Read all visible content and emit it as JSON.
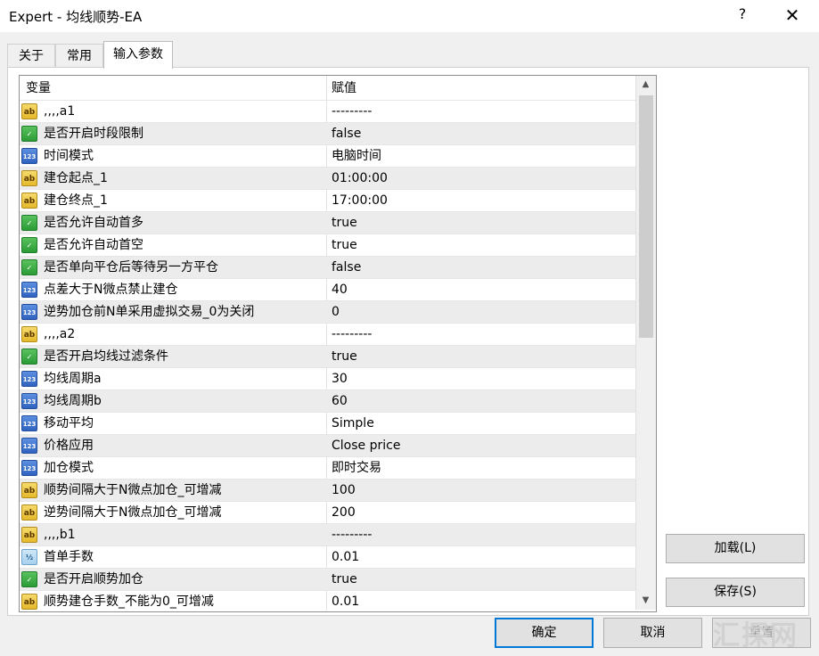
{
  "window": {
    "title": "Expert - 均线顺势-EA",
    "help": "?",
    "close": "✕"
  },
  "tabs": [
    {
      "label": "关于",
      "active": false
    },
    {
      "label": "常用",
      "active": false
    },
    {
      "label": "输入参数",
      "active": true
    }
  ],
  "grid": {
    "col_variable": "变量",
    "col_value": "赋值",
    "rows": [
      {
        "icon": "string",
        "badge": "ab",
        "name": ",,,,a1",
        "value": "---------"
      },
      {
        "icon": "bool",
        "badge": "✓",
        "name": "是否开启时段限制",
        "value": "false"
      },
      {
        "icon": "int",
        "badge": "123",
        "name": "时间模式",
        "value": "电脑时间"
      },
      {
        "icon": "string",
        "badge": "ab",
        "name": "建仓起点_1",
        "value": "01:00:00"
      },
      {
        "icon": "string",
        "badge": "ab",
        "name": "建仓终点_1",
        "value": "17:00:00"
      },
      {
        "icon": "bool",
        "badge": "✓",
        "name": "是否允许自动首多",
        "value": "true"
      },
      {
        "icon": "bool",
        "badge": "✓",
        "name": "是否允许自动首空",
        "value": "true"
      },
      {
        "icon": "bool",
        "badge": "✓",
        "name": "是否单向平仓后等待另一方平仓",
        "value": "false"
      },
      {
        "icon": "int",
        "badge": "123",
        "name": "点差大于N微点禁止建仓",
        "value": "40"
      },
      {
        "icon": "int",
        "badge": "123",
        "name": "逆势加仓前N单采用虚拟交易_0为关闭",
        "value": "0"
      },
      {
        "icon": "string",
        "badge": "ab",
        "name": ",,,,a2",
        "value": "---------"
      },
      {
        "icon": "bool",
        "badge": "✓",
        "name": "是否开启均线过滤条件",
        "value": "true"
      },
      {
        "icon": "int",
        "badge": "123",
        "name": "均线周期a",
        "value": "30"
      },
      {
        "icon": "int",
        "badge": "123",
        "name": "均线周期b",
        "value": "60"
      },
      {
        "icon": "int",
        "badge": "123",
        "name": "移动平均",
        "value": "Simple"
      },
      {
        "icon": "int",
        "badge": "123",
        "name": "价格应用",
        "value": "Close price"
      },
      {
        "icon": "int",
        "badge": "123",
        "name": "加仓模式",
        "value": "即时交易"
      },
      {
        "icon": "string",
        "badge": "ab",
        "name": "顺势间隔大于N微点加仓_可增减",
        "value": "100"
      },
      {
        "icon": "string",
        "badge": "ab",
        "name": "逆势间隔大于N微点加仓_可增减",
        "value": "200"
      },
      {
        "icon": "string",
        "badge": "ab",
        "name": ",,,,b1",
        "value": "---------"
      },
      {
        "icon": "double",
        "badge": "½",
        "name": "首单手数",
        "value": "0.01"
      },
      {
        "icon": "bool",
        "badge": "✓",
        "name": "是否开启顺势加仓",
        "value": "true"
      },
      {
        "icon": "string",
        "badge": "ab",
        "name": "顺势建仓手数_不能为0_可增减",
        "value": "0.01"
      }
    ]
  },
  "buttons": {
    "load": "加载(L)",
    "save": "保存(S)",
    "ok": "确定",
    "cancel": "取消",
    "reset": "重置"
  },
  "watermark": "汇探网"
}
